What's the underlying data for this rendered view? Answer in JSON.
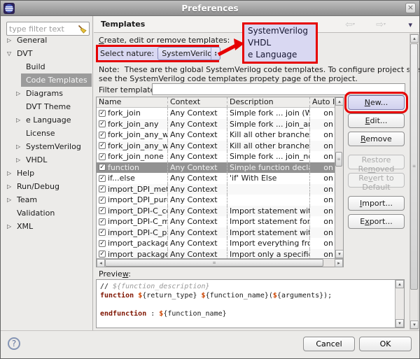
{
  "window": {
    "title": "Preferences"
  },
  "icons": {
    "close": "×",
    "help": "?",
    "nav_back": "⇦",
    "nav_forward": "⇨",
    "nav_caret": "▾",
    "view_menu": "▾",
    "combo_up": "▴",
    "combo_down": "▾",
    "check": "✓",
    "tree_collapsed": "▷",
    "tree_expanded": "▽",
    "scroll_up": "▴",
    "scroll_down": "▾",
    "scroll_left": "◂",
    "scroll_right": "▸",
    "grip": "≡"
  },
  "colors": {
    "annotation-red": "#e60000",
    "lavender": "#d9d8f2",
    "selection": "#929292",
    "keyword": "#7f1500",
    "dollar": "#cc4400",
    "comment": "#999999"
  },
  "sidebar": {
    "filter_placeholder": "type filter text",
    "tree": [
      {
        "label": "General",
        "arrow": "collapsed",
        "level": 0
      },
      {
        "label": "DVT",
        "arrow": "expanded",
        "level": 0
      },
      {
        "label": "Build",
        "arrow": "none",
        "level": 1
      },
      {
        "label": "Code Templates",
        "arrow": "none",
        "level": 1,
        "selected": true
      },
      {
        "label": "Diagrams",
        "arrow": "collapsed",
        "level": 1
      },
      {
        "label": "DVT Theme",
        "arrow": "none",
        "level": 1
      },
      {
        "label": "e Language",
        "arrow": "collapsed",
        "level": 1
      },
      {
        "label": "License",
        "arrow": "none",
        "level": 1
      },
      {
        "label": "SystemVerilog",
        "arrow": "collapsed",
        "level": 1
      },
      {
        "label": "VHDL",
        "arrow": "collapsed",
        "level": 1
      },
      {
        "label": "Help",
        "arrow": "collapsed",
        "level": 0
      },
      {
        "label": "Run/Debug",
        "arrow": "collapsed",
        "level": 0
      },
      {
        "label": "Team",
        "arrow": "collapsed",
        "level": 0
      },
      {
        "label": "Validation",
        "arrow": "none",
        "level": 0
      },
      {
        "label": "XML",
        "arrow": "collapsed",
        "level": 0
      }
    ]
  },
  "header": {
    "title": "Templates"
  },
  "content": {
    "create_label": {
      "text": "Create, edit or remove templates:",
      "mn": 0
    },
    "nature": {
      "label": "Select nature:",
      "value": "SystemVerilog",
      "options": [
        "SystemVerilog",
        "VHDL",
        "e Language"
      ]
    },
    "note_line1": "Note:  These are the global SystemVerilog code templates. To configure project specific templates",
    "note_line2": "see the SystemVerilog code templates propety page of the project.",
    "filter_label": "Filter templates:",
    "filter_value": "",
    "table": {
      "columns": [
        "Name",
        "Context",
        "Description",
        "Auto Insert"
      ],
      "rows": [
        {
          "checked": true,
          "name": "fork_join",
          "context": "Any Context",
          "description": "Simple fork ... join (Wait fo",
          "auto": "on"
        },
        {
          "checked": true,
          "name": "fork_join_any",
          "context": "Any Context",
          "description": "Simple fork ... join_any (W",
          "auto": "on"
        },
        {
          "checked": true,
          "name": "fork_join_any_with",
          "context": "Any Context",
          "description": "Kill all other branches of t",
          "auto": "on"
        },
        {
          "checked": true,
          "name": "fork_join_any_with",
          "context": "Any Context",
          "description": "Kill all other branches if a",
          "auto": "on"
        },
        {
          "checked": true,
          "name": "fork_join_none",
          "context": "Any Context",
          "description": "Simple fork ... join_none (",
          "auto": "on"
        },
        {
          "checked": true,
          "name": "function",
          "context": "Any Context",
          "description": "Simple function declaratio",
          "auto": "on",
          "selected": true
        },
        {
          "checked": true,
          "name": "if...else",
          "context": "Any Context",
          "description": "'if' With Else",
          "auto": "on"
        },
        {
          "checked": true,
          "name": "import_DPI_method",
          "context": "Any Context",
          "description": "",
          "auto": "on"
        },
        {
          "checked": true,
          "name": "import_DPI_pure_r",
          "context": "Any Context",
          "description": "",
          "auto": "on"
        },
        {
          "checked": true,
          "name": "import_DPI-C_cont",
          "context": "Any Context",
          "description": "Import statement with co",
          "auto": "on"
        },
        {
          "checked": true,
          "name": "import_DPI-C_met",
          "context": "Any Context",
          "description": "Import statement for C fu",
          "auto": "on"
        },
        {
          "checked": true,
          "name": "import_DPI-C_pure",
          "context": "Any Context",
          "description": "Import statement with pu",
          "auto": "on"
        },
        {
          "checked": true,
          "name": "import_package_a",
          "context": "Any Context",
          "description": "Import everything from a",
          "auto": "on"
        },
        {
          "checked": true,
          "name": "import_package_s",
          "context": "Any Context",
          "description": "Import only a specific fiel",
          "auto": "on"
        }
      ]
    },
    "actions": [
      {
        "label": "New...",
        "mn": 0,
        "focused": true,
        "annotated": true
      },
      {
        "label": "Edit...",
        "mn": 0
      },
      {
        "label": "Remove",
        "mn": 0
      },
      {
        "spacer": true
      },
      {
        "label": "Restore Removed",
        "mn": 10,
        "disabled": true
      },
      {
        "label": "Revert to Default",
        "mn": 2,
        "disabled": true
      },
      {
        "spacer": true
      },
      {
        "label": "Import...",
        "mn": 0
      },
      {
        "label": "Export...",
        "mn": 1
      }
    ],
    "preview": {
      "label": {
        "text": "Preview:",
        "mn": 6
      },
      "lines": [
        [
          {
            "t": "// ",
            "c": "pl"
          },
          {
            "t": "${function_description}",
            "c": "cmt"
          }
        ],
        [
          {
            "t": "function",
            "c": "kw"
          },
          {
            "t": " ",
            "c": "pl"
          },
          {
            "t": "$",
            "c": "dol"
          },
          {
            "t": "{return_type} ",
            "c": "pl"
          },
          {
            "t": "$",
            "c": "dol"
          },
          {
            "t": "{function_name}(",
            "c": "pl"
          },
          {
            "t": "$",
            "c": "dol"
          },
          {
            "t": "{arguments});",
            "c": "pl"
          }
        ],
        [],
        [
          {
            "t": "endfunction",
            "c": "kw"
          },
          {
            "t": " : ",
            "c": "pl"
          },
          {
            "t": "$",
            "c": "dol"
          },
          {
            "t": "{function_name}",
            "c": "pl"
          }
        ]
      ]
    }
  },
  "footer": {
    "cancel": "Cancel",
    "ok": "OK"
  }
}
